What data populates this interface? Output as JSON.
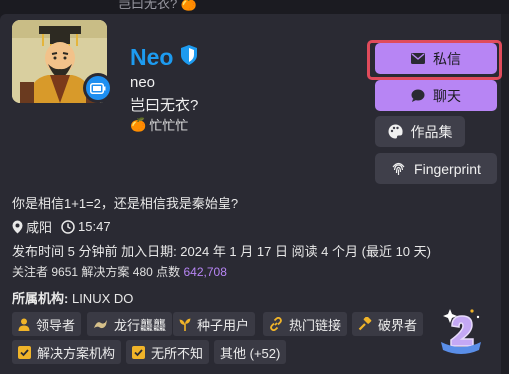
{
  "topbar": {
    "text": "岂曰无衣? 🍊"
  },
  "profile": {
    "display_name": "Neo",
    "username": "neo",
    "bio": "岂曰无衣?",
    "status_emoji": "🍊",
    "status_text": "忙忙忙",
    "tagline": "你是相信1+1=2，还是相信我是秦始皇?",
    "location": "咸阳",
    "local_time": "15:47",
    "meta_line": "发布时间 5 分钟前  加入日期:  2024 年 1 月 17 日  阅读 4 个月 (最近 10 天)",
    "followers_label": "关注者",
    "followers": "9651",
    "solutions_label": "解决方案",
    "solutions": "480",
    "points_label": "点数",
    "points": "642,708",
    "org_label": "所属机构:",
    "org_value": "LINUX DO"
  },
  "buttons": {
    "message": "私信",
    "chat": "聊天",
    "portfolio": "作品集",
    "fingerprint": "Fingerprint"
  },
  "badges": [
    {
      "label": "领导者",
      "icon": "user-icon"
    },
    {
      "label": "龙行龘龘",
      "icon": "dragon-icon"
    },
    {
      "label": "种子用户",
      "icon": "sprout-icon"
    },
    {
      "label": "热门链接",
      "icon": "link-icon"
    },
    {
      "label": "破界者",
      "icon": "hammer-icon"
    },
    {
      "label": "解决方案机构",
      "icon": "checkbox-icon"
    },
    {
      "label": "无所不知",
      "icon": "checkbox-icon"
    },
    {
      "label": "其他 (+52)",
      "icon": ""
    }
  ],
  "colors": {
    "accent": "#b785f4",
    "brand_blue": "#1d9bf0",
    "highlight": "#e04b5b",
    "badge_gold": "#f0b429"
  }
}
